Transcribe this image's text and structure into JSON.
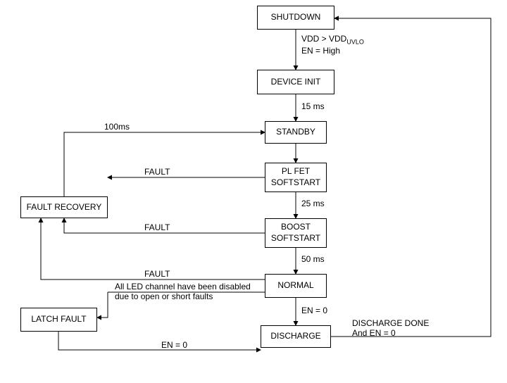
{
  "states": {
    "shutdown": "SHUTDOWN",
    "device_init": "DEVICE INIT",
    "standby": "STANDBY",
    "plfet": "PL FET\nSOFTSTART",
    "boost": "BOOST\nSOFTSTART",
    "normal": "NORMAL",
    "discharge": "DISCHARGE",
    "fault_recovery": "FAULT RECOVERY",
    "latch_fault": "LATCH FAULT"
  },
  "edges": {
    "shutdown_to_init_1": "VDD > VDD",
    "shutdown_to_init_sub": "UVLO",
    "shutdown_to_init_2": "EN = High",
    "init_to_standby": "15 ms",
    "plfet_to_boost": "25 ms",
    "boost_to_normal": "50 ms",
    "normal_to_discharge": "EN = 0",
    "discharge_to_shutdown_1": "DISCHARGE DONE",
    "discharge_to_shutdown_2": "And EN = 0",
    "recovery_to_standby": "100ms",
    "plfet_fault": "FAULT",
    "boost_fault": "FAULT",
    "normal_fault": "FAULT",
    "latch_to_discharge": "EN = 0",
    "normal_to_latch_1": "All LED channel have been disabled",
    "normal_to_latch_2": "due to open or short faults"
  }
}
